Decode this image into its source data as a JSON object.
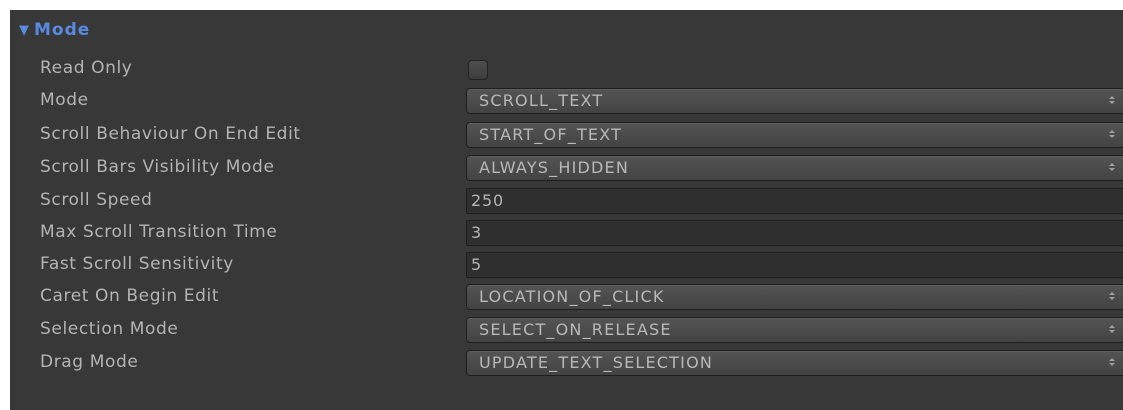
{
  "section": {
    "title": "Mode",
    "arrow_icon": "foldout-expanded-icon"
  },
  "fields": {
    "read_only": {
      "label": "Read Only",
      "checked": false
    },
    "mode": {
      "label": "Mode",
      "value": "SCROLL_TEXT"
    },
    "scroll_behaviour": {
      "label": "Scroll Behaviour On End Edit",
      "value": "START_OF_TEXT"
    },
    "scroll_bars_visibility": {
      "label": "Scroll Bars Visibility Mode",
      "value": "ALWAYS_HIDDEN"
    },
    "scroll_speed": {
      "label": "Scroll Speed",
      "value": "250"
    },
    "max_scroll_transition": {
      "label": "Max Scroll Transition Time",
      "value": "3"
    },
    "fast_scroll_sensitivity": {
      "label": "Fast Scroll Sensitivity",
      "value": "5"
    },
    "caret_on_begin_edit": {
      "label": "Caret On Begin Edit",
      "value": "LOCATION_OF_CLICK"
    },
    "selection_mode": {
      "label": "Selection Mode",
      "value": "SELECT_ON_RELEASE"
    },
    "drag_mode": {
      "label": "Drag Mode",
      "value": "UPDATE_TEXT_SELECTION"
    }
  },
  "colors": {
    "background": "#383838",
    "header_text": "#5a8ae0",
    "label_text": "#b4b4b4"
  }
}
